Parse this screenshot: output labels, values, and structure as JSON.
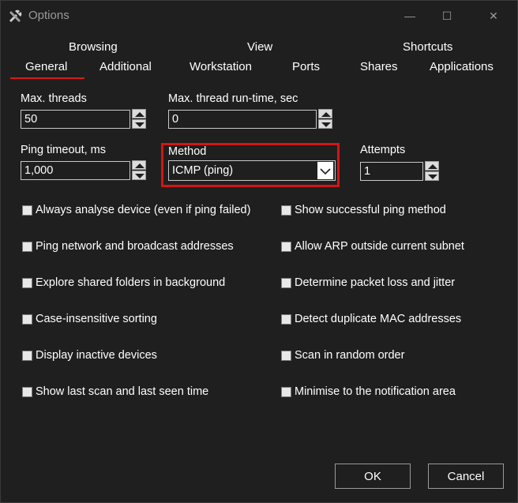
{
  "window": {
    "title": "Options",
    "icon": "tools-icon",
    "controls": {
      "minimize": "—",
      "maximize": "☐",
      "close": "✕"
    }
  },
  "tabs_row1": [
    "Browsing",
    "View",
    "Shortcuts"
  ],
  "tabs_row2": [
    "General",
    "Additional",
    "Workstation",
    "Ports",
    "Shares",
    "Applications"
  ],
  "active_tab": "General",
  "fields": {
    "max_threads": {
      "label": "Max. threads",
      "value": "50"
    },
    "max_runtime": {
      "label": "Max. thread run-time, sec",
      "value": "0"
    },
    "ping_timeout": {
      "label": "Ping timeout, ms",
      "value": "1,000"
    },
    "method": {
      "label": "Method",
      "value": "ICMP (ping)"
    },
    "attempts": {
      "label": "Attempts",
      "value": "1"
    }
  },
  "checkboxes_left": [
    "Always analyse device (even if ping failed)",
    "Ping network and broadcast addresses",
    "Explore shared folders in background",
    "Case-insensitive sorting",
    "Display inactive devices",
    "Show last scan and last seen time"
  ],
  "checkboxes_right": [
    "Show successful ping method",
    "Allow ARP outside current subnet",
    "Determine packet loss and jitter",
    "Detect duplicate MAC addresses",
    "Scan in random order",
    "Minimise to the notification area"
  ],
  "buttons": {
    "ok": "OK",
    "cancel": "Cancel"
  },
  "colors": {
    "background": "#1f1f1f",
    "accent": "#d81b1b",
    "highlight": "#d41515"
  }
}
